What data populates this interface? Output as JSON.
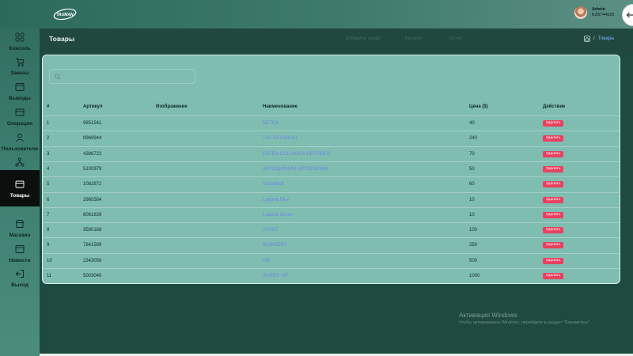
{
  "logo": {
    "text": "TAUMAN"
  },
  "user": {
    "name": "Admin",
    "id": "KZ8744520"
  },
  "sidebar": {
    "items": [
      {
        "label": "Консоль",
        "icon": "grid-icon",
        "active": false
      },
      {
        "label": "Заказы",
        "icon": "cart-icon",
        "active": false
      },
      {
        "label": "Выводы",
        "icon": "wallet-icon",
        "active": false
      },
      {
        "label": "Операции",
        "icon": "card-icon",
        "active": false
      },
      {
        "label": "Пользователи",
        "icon": "users-icon",
        "active": false
      },
      {
        "label": "Структура",
        "icon": "structure-icon",
        "active": false
      },
      {
        "label": "Товары",
        "icon": "box-icon",
        "active": true
      },
      {
        "label": "Магазин",
        "icon": "store-icon",
        "active": false
      },
      {
        "label": "Новости",
        "icon": "news-icon",
        "active": false
      },
      {
        "label": "Выход",
        "icon": "logout-icon",
        "active": false
      }
    ]
  },
  "header": {
    "title": "Товары",
    "links": [
      "Добавить товар",
      "Каталог",
      "Отчёт"
    ],
    "breadcrumb_current": "Товары"
  },
  "table": {
    "headers": [
      "#",
      "Артикул",
      "Изображение",
      "Наименование",
      "Цена ($)",
      "Действие"
    ],
    "rows": [
      {
        "n": "1",
        "sku": "9851541",
        "name": "DETOX",
        "price": "40",
        "action": "Удалить"
      },
      {
        "n": "2",
        "sku": "8969944",
        "name": "ТАУ ПАТШАСЫ",
        "price": "240",
        "action": "Удалить"
      },
      {
        "n": "3",
        "sku": "4386722",
        "name": "EXTRA COLLAGEN PEPTIDES",
        "price": "70",
        "action": "Удалить"
      },
      {
        "n": "4",
        "sku": "5100979",
        "name": "ХИТОЦИАНИН (HITOCIANIN)",
        "price": "50",
        "action": "Удалить"
      },
      {
        "n": "5",
        "sku": "1082872",
        "name": "VisionBoll",
        "price": "60",
        "action": "Удалить"
      },
      {
        "n": "6",
        "sku": "2960584",
        "name": "Laguna Blue",
        "price": "10",
        "action": "Удалить"
      },
      {
        "n": "7",
        "sku": "8061639",
        "name": "Laguna Green",
        "price": "10",
        "action": "Удалить"
      },
      {
        "n": "8",
        "sku": "3590168",
        "name": "START",
        "price": "100",
        "action": "Удалить"
      },
      {
        "n": "9",
        "sku": "7841599",
        "name": "BUSINESS",
        "price": "250",
        "action": "Удалить"
      },
      {
        "n": "10",
        "sku": "2343056",
        "name": "VIP",
        "price": "500",
        "action": "Удалить"
      },
      {
        "n": "11",
        "sku": "5003040",
        "name": "SUPER VIP",
        "price": "1000",
        "action": "Удалить"
      }
    ]
  },
  "watermark": {
    "title": "Активация Windows",
    "subtitle": "Чтобы активировать Windows, перейдите в раздел \"Параметры\"."
  },
  "colors": {
    "accent": "#e8415f",
    "link": "#6c86e6",
    "card": "#7fbdb1"
  }
}
